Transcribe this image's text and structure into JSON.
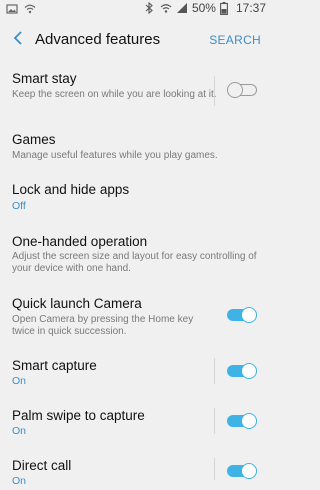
{
  "status_bar": {
    "battery_percent": "50%",
    "time": "17:37",
    "icons": [
      "image-icon",
      "wifi-icon",
      "bluetooth-icon",
      "wifi-calling-icon",
      "signal-icon",
      "battery-icon"
    ]
  },
  "header": {
    "title": "Advanced features",
    "search_label": "SEARCH"
  },
  "items": [
    {
      "title": "Smart stay",
      "desc": "Keep the screen on while you are looking at it.",
      "toggle": "off"
    },
    {
      "title": "Games",
      "desc": "Manage useful features while you play games."
    },
    {
      "title": "Lock and hide apps",
      "status": "Off"
    },
    {
      "title": "One-handed operation",
      "desc": "Adjust the screen size and layout for easy controlling of your device with one hand."
    },
    {
      "title": "Quick launch Camera",
      "desc": "Open Camera by pressing the Home key twice in quick succession.",
      "toggle": "on"
    },
    {
      "title": "Smart capture",
      "status": "On",
      "toggle": "on"
    },
    {
      "title": "Palm swipe to capture",
      "status": "On",
      "toggle": "on"
    },
    {
      "title": "Direct call",
      "status": "On",
      "toggle": "on"
    }
  ],
  "colors": {
    "accent": "#3a8fc8",
    "toggle_on": "#3fb3e6",
    "background": "#f0f0f0"
  }
}
